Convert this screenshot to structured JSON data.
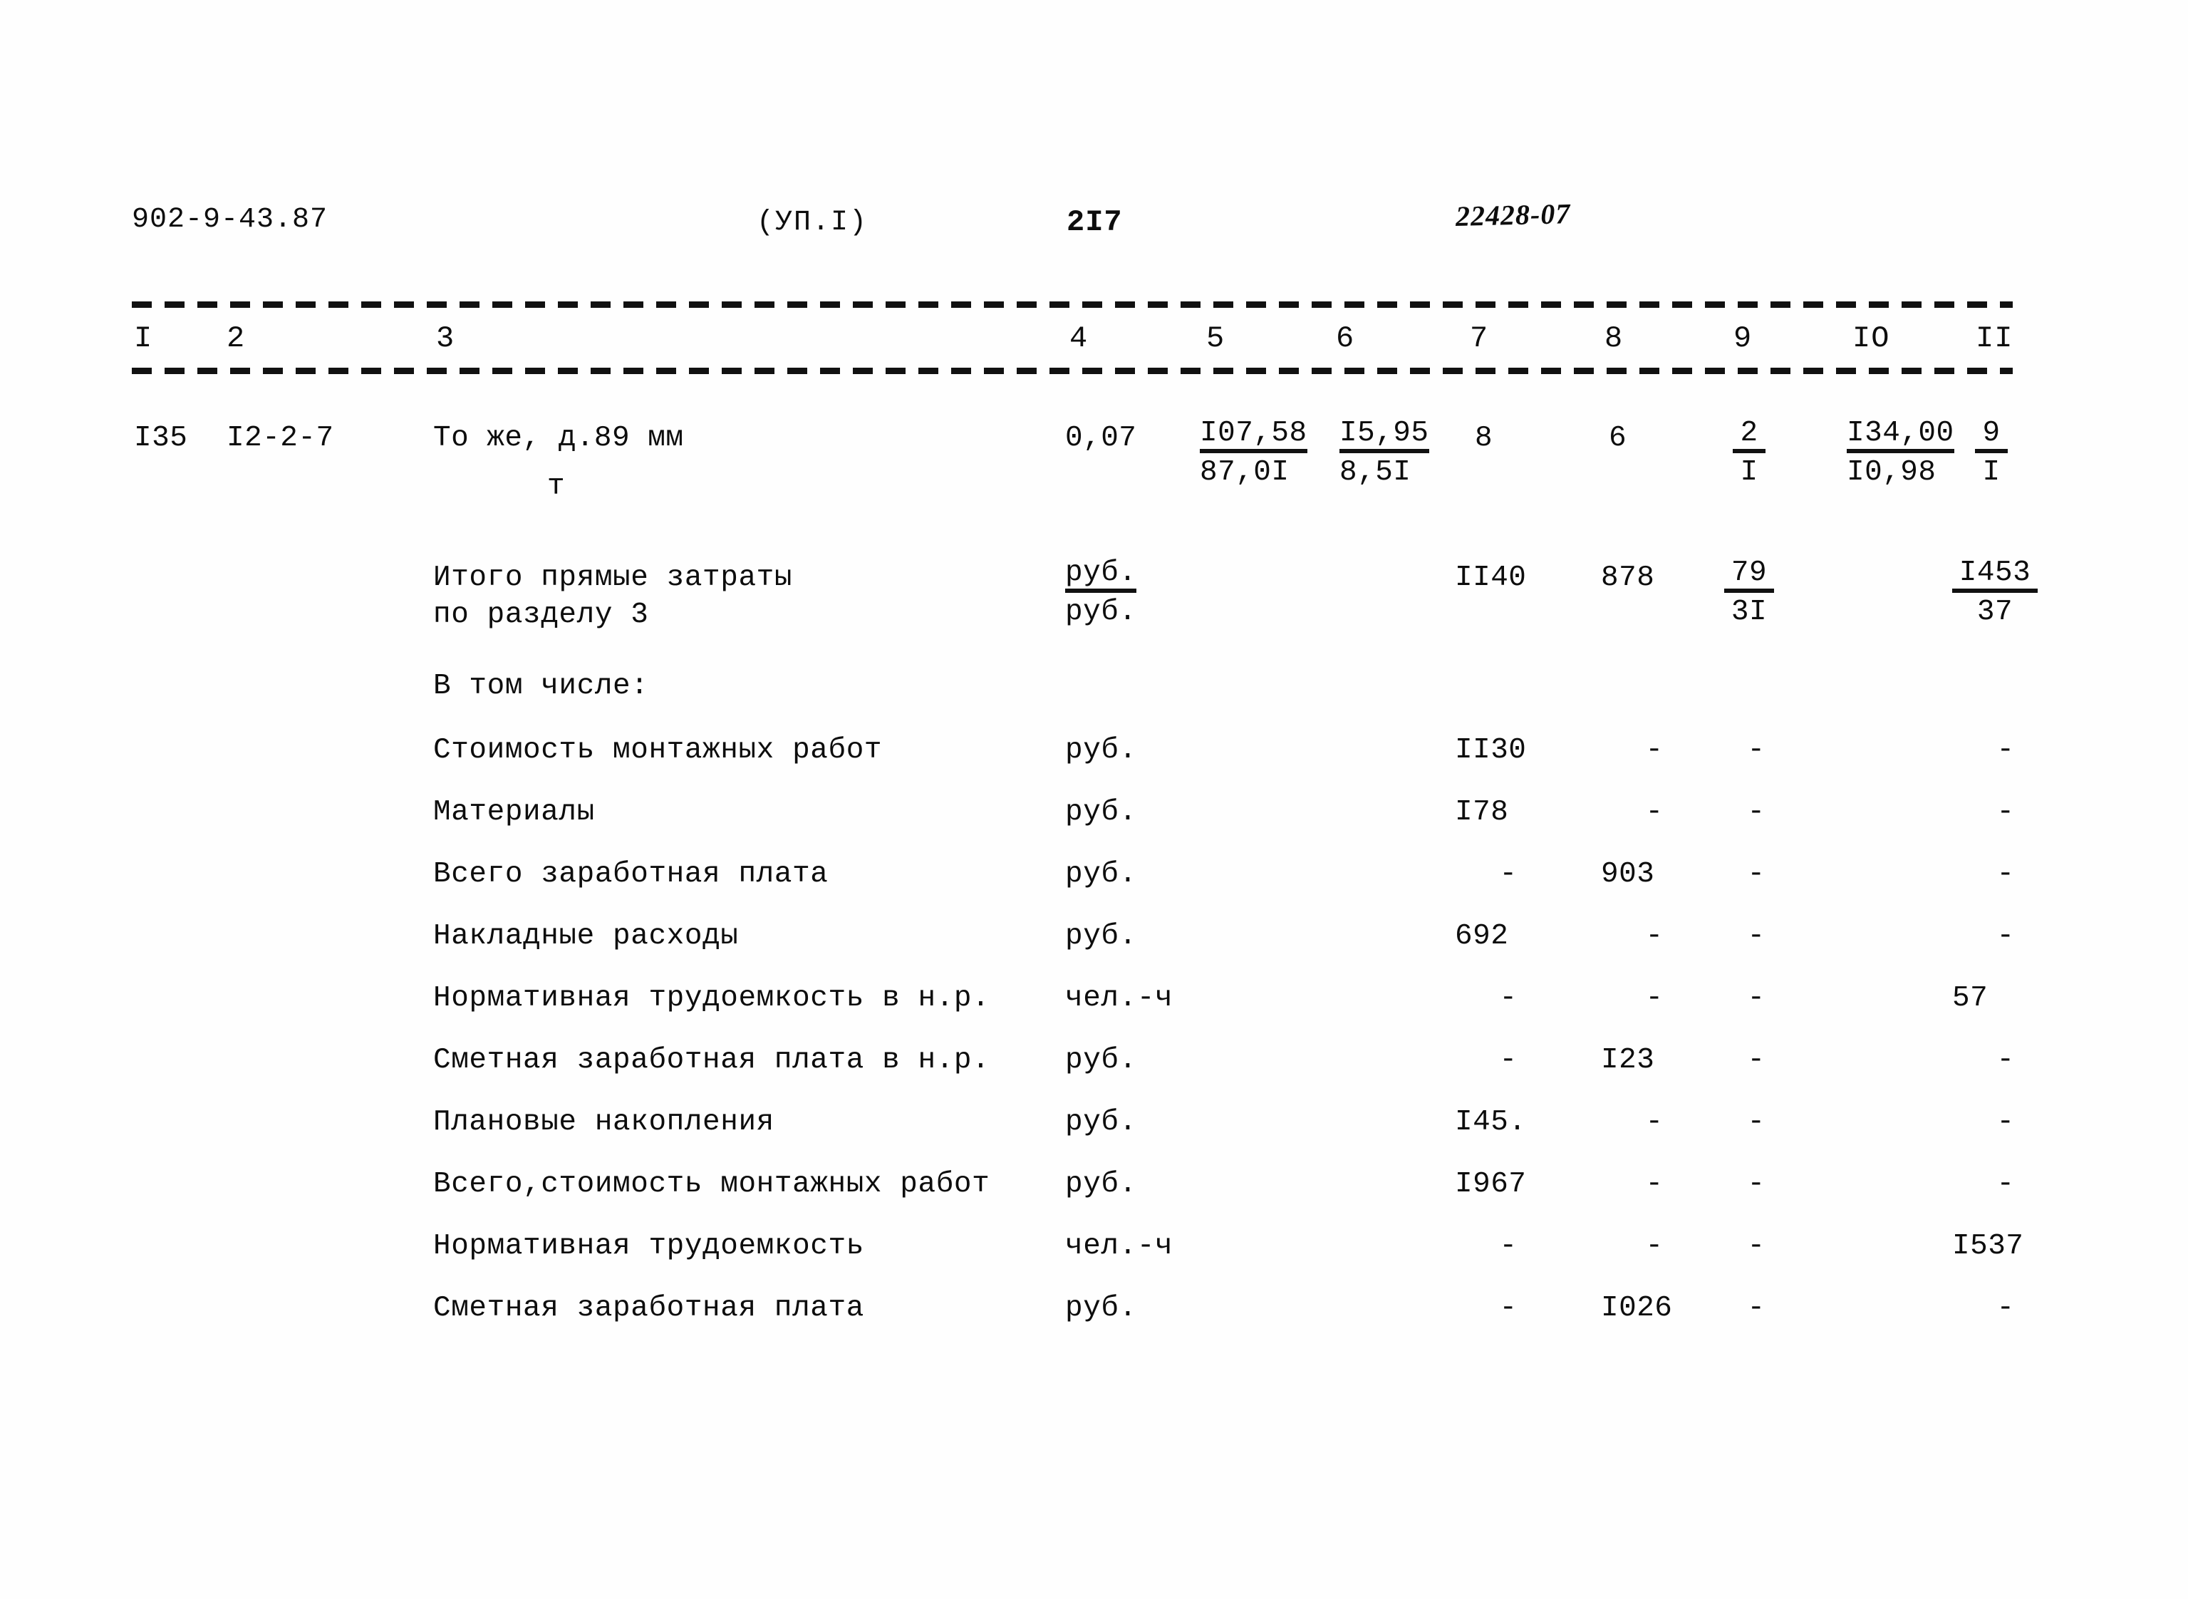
{
  "header": {
    "document_code": "902-9-43.87",
    "volume": "(УП.I)",
    "page_number": "2I7",
    "stamp": "22428-07"
  },
  "table": {
    "column_numbers": [
      "I",
      "2",
      "3",
      "4",
      "5",
      "6",
      "7",
      "8",
      "9",
      "IO",
      "II"
    ],
    "work_row": {
      "position": "I35",
      "code": "I2-2-7",
      "description": "То же, д.89 мм",
      "unit": "т",
      "quantity": "0,07",
      "col5_num": "I07,58",
      "col5_den": "87,0I",
      "col6_num": "I5,95",
      "col6_den": "8,5I",
      "col7": "8",
      "col8": "6",
      "col9_num": "2",
      "col9_den": "I",
      "col10_num": "I34,00",
      "col10_den": "I0,98",
      "col11_num": "9",
      "col11_den": "I"
    },
    "total_row": {
      "label_line1": "Итого прямые затраты",
      "label_line2": "по разделу 3",
      "unit_num": "руб.",
      "unit_den": "руб.",
      "col7": "II40",
      "col8": "878",
      "col9_num": "79",
      "col9_den": "3I",
      "col11_num": "I453",
      "col11_den": "37"
    },
    "breakdown_heading": "В том числе:",
    "breakdown_rows": [
      {
        "label": "Стоимость монтажных работ",
        "unit": "руб.",
        "col7": "II30",
        "col8": "-",
        "col9": "-",
        "col11": "-"
      },
      {
        "label": "Материалы",
        "unit": "руб.",
        "col7": "I78",
        "col8": "-",
        "col9": "-",
        "col11": "-"
      },
      {
        "label": "Всего заработная плата",
        "unit": "руб.",
        "col7": "-",
        "col8": "903",
        "col9": "-",
        "col11": "-"
      },
      {
        "label": "Накладные расходы",
        "unit": "руб.",
        "col7": "692",
        "col8": "-",
        "col9": "-",
        "col11": "-"
      },
      {
        "label": "Нормативная трудоемкость в н.р.",
        "unit": "чел.-ч",
        "col7": "-",
        "col8": "-",
        "col9": "-",
        "col11": "57"
      },
      {
        "label": "Сметная заработная плата в н.р.",
        "unit": "руб.",
        "col7": "-",
        "col8": "I23",
        "col9": "-",
        "col11": "-"
      },
      {
        "label": "Плановые накопления",
        "unit": "руб.",
        "col7": "I45.",
        "col8": "-",
        "col9": "-",
        "col11": "-"
      },
      {
        "label": "Всего,стоимость монтажных работ",
        "unit": "руб.",
        "col7": "I967",
        "col8": "-",
        "col9": "-",
        "col11": "-"
      },
      {
        "label": "Нормативная трудоемкость",
        "unit": "чел.-ч",
        "col7": "-",
        "col8": "-",
        "col9": "-",
        "col11": "I537"
      },
      {
        "label": "Сметная заработная плата",
        "unit": "руб.",
        "col7": "-",
        "col8": "I026",
        "col9": "-",
        "col11": "-"
      }
    ]
  }
}
